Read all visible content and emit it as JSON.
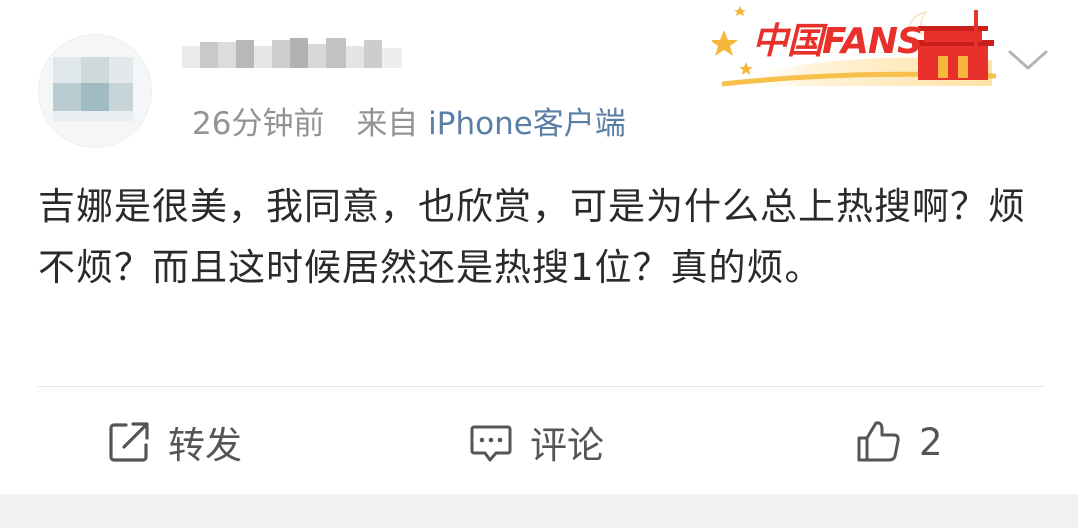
{
  "post_meta": {
    "time": "26分钟前",
    "source_prefix": "来自",
    "client": "iPhone客户端"
  },
  "badge": {
    "text": "中国FANS",
    "icon": "china-fans-badge"
  },
  "post": {
    "text": "吉娜是很美，我同意，也欣赏，可是为什么总上热搜啊？烦不烦？而且这时候居然还是热搜1位？真的烦。"
  },
  "actions": {
    "repost_label": "转发",
    "comment_label": "评论",
    "like_count": "2"
  },
  "icons": {
    "repost": "share-square-arrow-icon",
    "comment": "speech-bubble-icon",
    "like": "thumbs-up-icon",
    "more": "chevron-down-icon"
  },
  "colors": {
    "link": "#5a7fa6",
    "meta": "#939393",
    "badge_red": "#e8312a",
    "badge_gold": "#f6b73c"
  }
}
